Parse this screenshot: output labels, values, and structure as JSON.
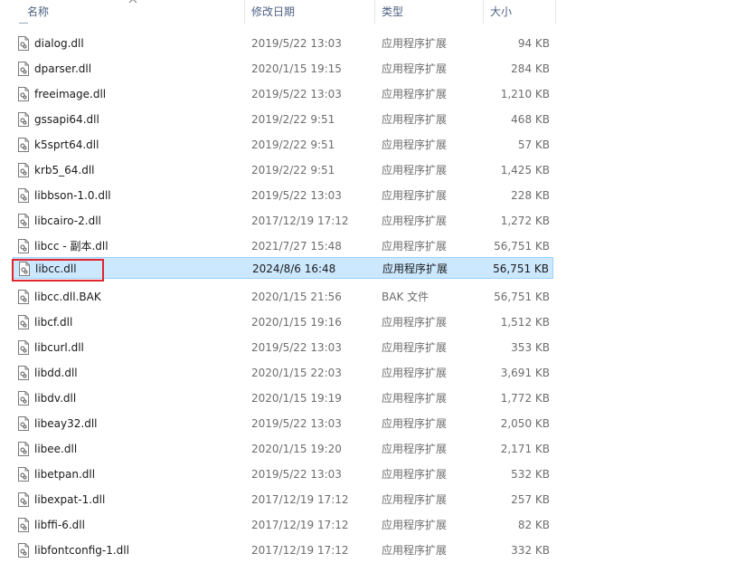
{
  "header": {
    "name": "名称",
    "date": "修改日期",
    "type": "类型",
    "size": "大小"
  },
  "colors": {
    "selected_bg": "#cce8ff",
    "selected_border": "#99d1ff",
    "highlight": "#e0242c",
    "header_text": "#4d6082"
  },
  "icons": {
    "file": "dll-file-icon",
    "sort": "sort-ascending-chevron-icon"
  },
  "files": [
    {
      "name": "dialog.dll",
      "date": "2019/5/22 13:03",
      "type": "应用程序扩展",
      "size": "94 KB"
    },
    {
      "name": "dparser.dll",
      "date": "2020/1/15 19:15",
      "type": "应用程序扩展",
      "size": "284 KB"
    },
    {
      "name": "freeimage.dll",
      "date": "2019/5/22 13:03",
      "type": "应用程序扩展",
      "size": "1,210 KB"
    },
    {
      "name": "gssapi64.dll",
      "date": "2019/2/22 9:51",
      "type": "应用程序扩展",
      "size": "468 KB"
    },
    {
      "name": "k5sprt64.dll",
      "date": "2019/2/22 9:51",
      "type": "应用程序扩展",
      "size": "57 KB"
    },
    {
      "name": "krb5_64.dll",
      "date": "2019/2/22 9:51",
      "type": "应用程序扩展",
      "size": "1,425 KB"
    },
    {
      "name": "libbson-1.0.dll",
      "date": "2019/5/22 13:03",
      "type": "应用程序扩展",
      "size": "228 KB"
    },
    {
      "name": "libcairo-2.dll",
      "date": "2017/12/19 17:12",
      "type": "应用程序扩展",
      "size": "1,272 KB"
    },
    {
      "name": "libcc - 副本.dll",
      "date": "2021/7/27 15:48",
      "type": "应用程序扩展",
      "size": "56,751 KB"
    },
    {
      "name": "libcc.dll",
      "date": "2024/8/6 16:48",
      "type": "应用程序扩展",
      "size": "56,751 KB",
      "selected": true
    },
    {
      "name": "libcc.dll.BAK",
      "date": "2020/1/15 21:56",
      "type": "BAK 文件",
      "size": "56,751 KB"
    },
    {
      "name": "libcf.dll",
      "date": "2020/1/15 19:16",
      "type": "应用程序扩展",
      "size": "1,512 KB"
    },
    {
      "name": "libcurl.dll",
      "date": "2019/5/22 13:03",
      "type": "应用程序扩展",
      "size": "353 KB"
    },
    {
      "name": "libdd.dll",
      "date": "2020/1/15 22:03",
      "type": "应用程序扩展",
      "size": "3,691 KB"
    },
    {
      "name": "libdv.dll",
      "date": "2020/1/15 19:19",
      "type": "应用程序扩展",
      "size": "1,772 KB"
    },
    {
      "name": "libeay32.dll",
      "date": "2019/5/22 13:03",
      "type": "应用程序扩展",
      "size": "2,050 KB"
    },
    {
      "name": "libee.dll",
      "date": "2020/1/15 19:20",
      "type": "应用程序扩展",
      "size": "2,171 KB"
    },
    {
      "name": "libetpan.dll",
      "date": "2019/5/22 13:03",
      "type": "应用程序扩展",
      "size": "532 KB"
    },
    {
      "name": "libexpat-1.dll",
      "date": "2017/12/19 17:12",
      "type": "应用程序扩展",
      "size": "257 KB"
    },
    {
      "name": "libffi-6.dll",
      "date": "2017/12/19 17:12",
      "type": "应用程序扩展",
      "size": "82 KB"
    },
    {
      "name": "libfontconfig-1.dll",
      "date": "2017/12/19 17:12",
      "type": "应用程序扩展",
      "size": "332 KB"
    }
  ]
}
